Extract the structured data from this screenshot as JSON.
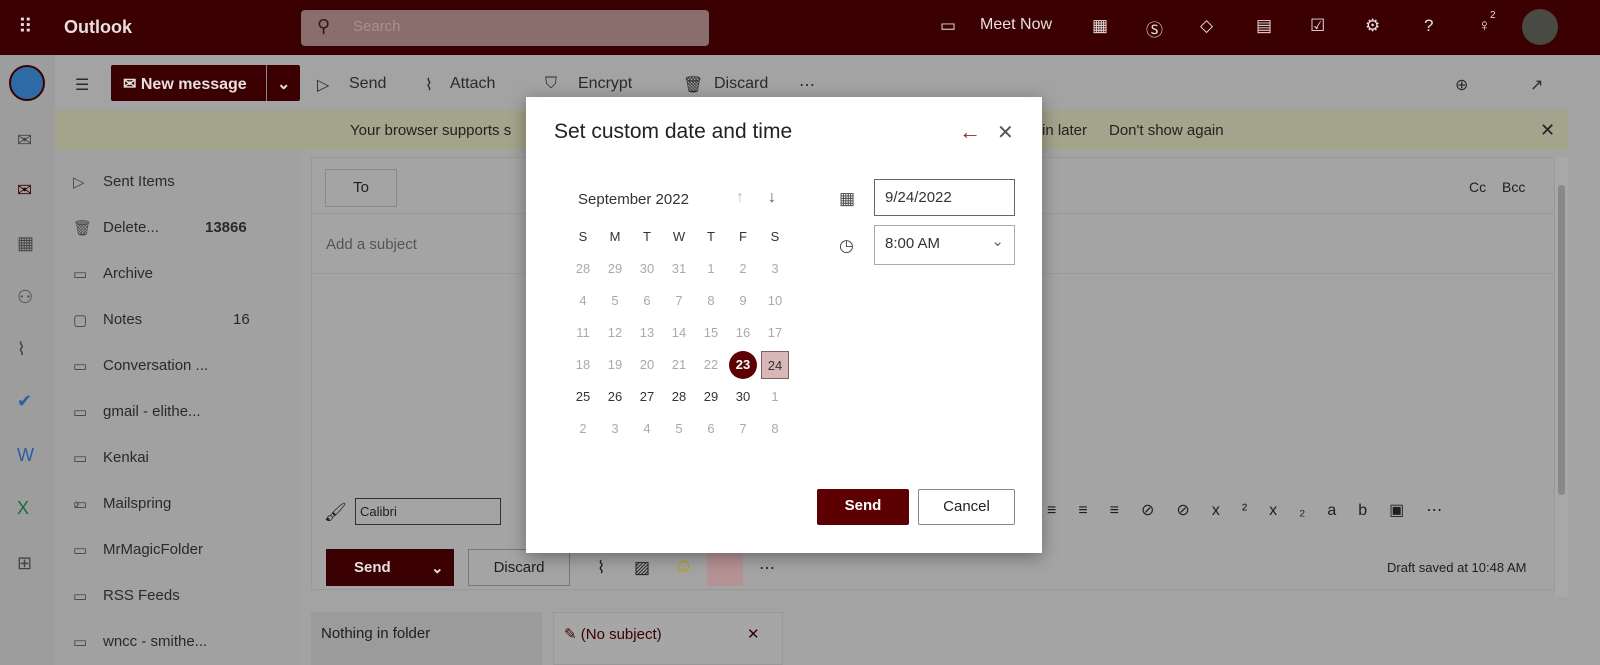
{
  "header": {
    "app_name": "Outlook",
    "search_placeholder": "Search",
    "meet_now": "Meet Now",
    "notification_count": "2"
  },
  "toolbar": {
    "new_message": "New message",
    "send": "Send",
    "attach": "Attach",
    "encrypt": "Encrypt",
    "discard": "Discard"
  },
  "banner": {
    "text_start": "Your browser supports s",
    "text_end": "in later",
    "dont_show": "Don't show again"
  },
  "folders": [
    {
      "label": "Sent Items",
      "icon": "send-icon"
    },
    {
      "label": "Delete...",
      "count": "13866",
      "icon": "trash-icon"
    },
    {
      "label": "Archive",
      "icon": "archive-icon"
    },
    {
      "label": "Notes",
      "count": "16",
      "icon": "note-icon"
    },
    {
      "label": "Conversation ...",
      "icon": "folder-icon"
    },
    {
      "label": "gmail - elithe...",
      "icon": "folder-icon"
    },
    {
      "label": "Kenkai",
      "icon": "folder-icon"
    },
    {
      "label": "Mailspring",
      "icon": "folder-icon"
    },
    {
      "label": "MrMagicFolder",
      "icon": "folder-icon"
    },
    {
      "label": "RSS Feeds",
      "icon": "folder-icon"
    },
    {
      "label": "wncc - smithe...",
      "icon": "folder-icon"
    }
  ],
  "compose": {
    "to": "To",
    "cc": "Cc",
    "bcc": "Bcc",
    "subject_placeholder": "Add a subject",
    "font": "Calibri",
    "send": "Send",
    "discard": "Discard",
    "draft_status": "Draft saved at 10:48 AM"
  },
  "tabs": {
    "nothing": "Nothing in folder",
    "draft": "(No subject)"
  },
  "dialog": {
    "title": "Set custom date and time",
    "month": "September 2022",
    "weekdays": [
      "S",
      "M",
      "T",
      "W",
      "T",
      "F",
      "S"
    ],
    "weeks": [
      [
        "28",
        "29",
        "30",
        "31",
        "1",
        "2",
        "3"
      ],
      [
        "4",
        "5",
        "6",
        "7",
        "8",
        "9",
        "10"
      ],
      [
        "11",
        "12",
        "13",
        "14",
        "15",
        "16",
        "17"
      ],
      [
        "18",
        "19",
        "20",
        "21",
        "22",
        "23",
        "24"
      ],
      [
        "25",
        "26",
        "27",
        "28",
        "29",
        "30",
        "1"
      ],
      [
        "2",
        "3",
        "4",
        "5",
        "6",
        "7",
        "8"
      ]
    ],
    "today": "23",
    "selected": "24",
    "date_value": "9/24/2022",
    "time_value": "8:00 AM",
    "send": "Send",
    "cancel": "Cancel"
  },
  "colors": {
    "brand": "#5c0003",
    "topbar": "#3a0002",
    "selected_day": "#d7b7b8"
  }
}
